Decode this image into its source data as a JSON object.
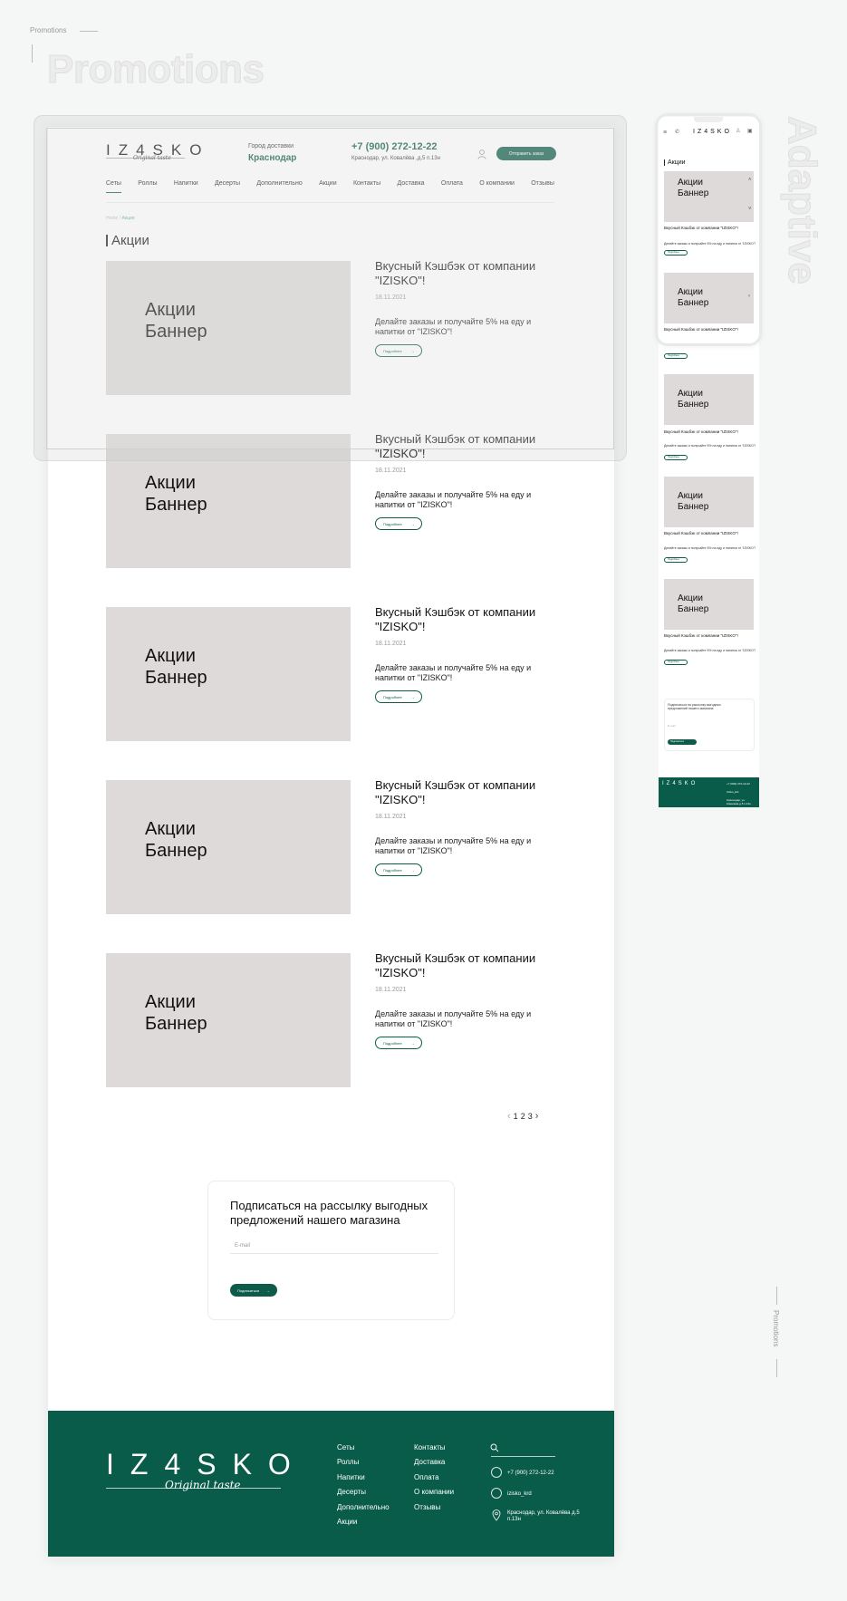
{
  "top": {
    "crumb": "Promotions",
    "title": "Promotions",
    "adaptive": "Adaptive",
    "side_label": "Promotions"
  },
  "header": {
    "logo": "IZ4SKO",
    "logo_sub": "Original taste",
    "city_label": "Город доставки",
    "city": "Краснодар",
    "phone": "+7 (900) 272-12-22",
    "address": "Краснодар, ул. Ковалёва ,д.5 п.13н",
    "order_button": "Отправить заказ"
  },
  "nav": [
    "Сеты",
    "Роллы",
    "Напитки",
    "Десерты",
    "Дополнительно",
    "Акции",
    "Контакты",
    "Доставка",
    "Оплата",
    "О компании",
    "Отзывы"
  ],
  "breadcrumb": {
    "home": "Home",
    "current": "Акции"
  },
  "page_title": "Акции",
  "promos": [
    {
      "banner": "Акции Баннер",
      "title": "Вкусный Кэшбэк от компании \"IZISKO\"!",
      "date": "18.11.2021",
      "desc": "Делайте заказы и получайте 5% на еду и напитки от \"IZISKO\"!",
      "button": "Подробнее"
    },
    {
      "banner": "Акции Баннер",
      "title": "Вкусный Кэшбэк от компании \"IZISKO\"!",
      "date": "18.11.2021",
      "desc": "Делайте заказы и получайте 5% на еду и напитки от \"IZISKO\"!",
      "button": "Подробнее"
    },
    {
      "banner": "Акции Баннер",
      "title": "Вкусный Кэшбэк от компании \"IZISKO\"!",
      "date": "18.11.2021",
      "desc": "Делайте заказы и получайте 5% на еду и напитки от \"IZISKO\"!",
      "button": "Подробнее"
    },
    {
      "banner": "Акции Баннер",
      "title": "Вкусный Кэшбэк от компании \"IZISKO\"!",
      "date": "18.11.2021",
      "desc": "Делайте заказы и получайте 5% на еду и напитки от \"IZISKO\"!",
      "button": "Подробнее"
    },
    {
      "banner": "Акции Баннер",
      "title": "Вкусный Кэшбэк от компании \"IZISKO\"!",
      "date": "18.11.2021",
      "desc": "Делайте заказы и получайте 5% на еду и напитки от \"IZISKO\"!",
      "button": "Подробнее"
    }
  ],
  "pagination": {
    "pages": [
      "1",
      "2",
      "3"
    ],
    "prev": "‹",
    "next": "›"
  },
  "subscribe": {
    "title": "Подписаться на рассылку выгодных предложений нашего магазина",
    "placeholder": "E-mail",
    "button": "Подписаться"
  },
  "footer": {
    "col1": [
      "Сеты",
      "Роллы",
      "Напитки",
      "Десерты",
      "Дополнительно",
      "Акции"
    ],
    "col2": [
      "Контакты",
      "Доставка",
      "Оплата",
      "О компании",
      "Отзывы"
    ],
    "phone": "+7 (900) 272-12-22",
    "instagram": "izisko_krd",
    "address": "Краснодар, ул. Ковалёва д.5 п.13н"
  },
  "mobile": {
    "title": "Акции",
    "promo_title": "Вкусный Кэшбэк от компании \"IZISKO\"!",
    "promo_desc": "Делайте заказы и получайте 5% на еду и напитки от \"IZISKO\"!",
    "subscribe_title": "Подписаться на рассылку выгодных предложений нашего магазина",
    "button": "Подробнее",
    "subscribe_button": "Подписаться"
  },
  "colors": {
    "brand": "#0d5c4a",
    "banner": "#dedad9"
  }
}
